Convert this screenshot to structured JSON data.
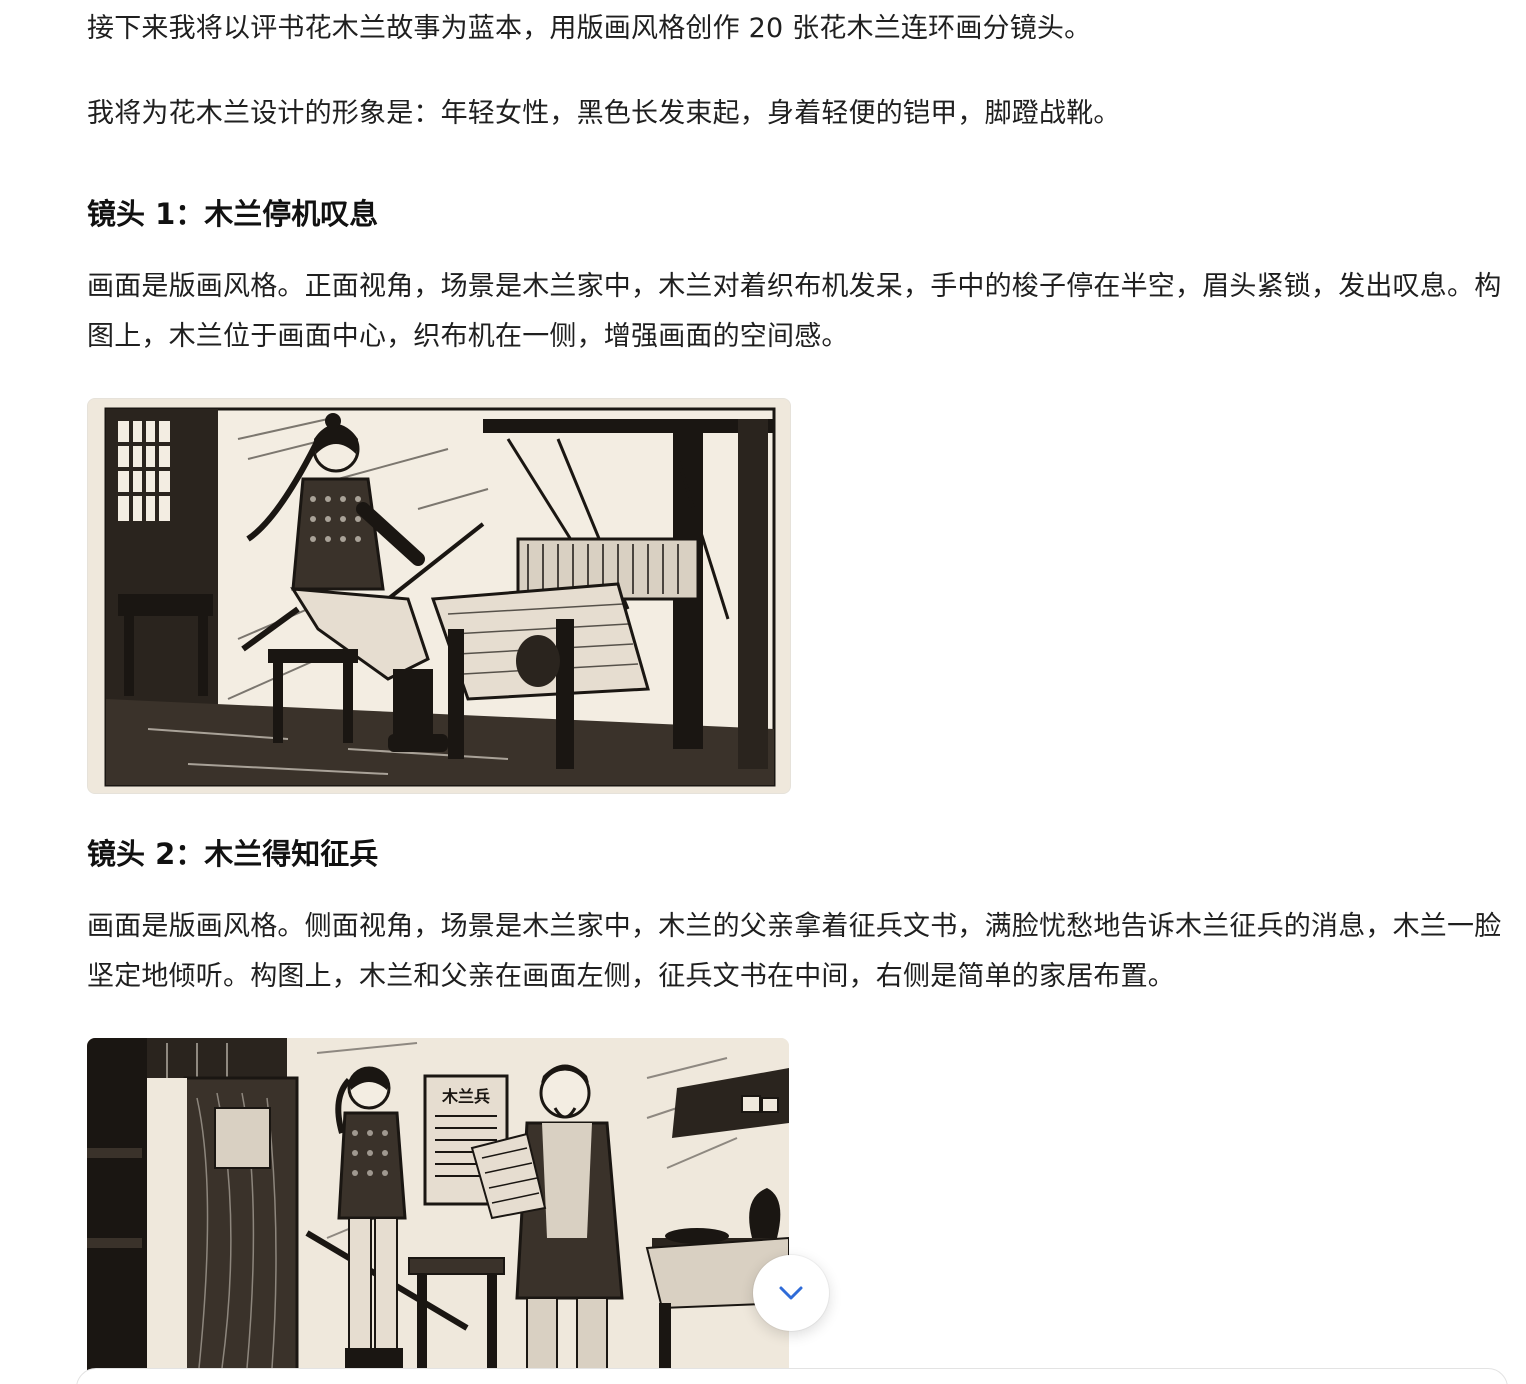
{
  "intro": {
    "line1": "接下来我将以评书花木兰故事为蓝本，用版画风格创作 20 张花木兰连环画分镜头。",
    "line2": "我将为花木兰设计的形象是：年轻女性，黑色长发束起，身着轻便的铠甲，脚蹬战靴。"
  },
  "shots": [
    {
      "title": "镜头 1：木兰停机叹息",
      "description": "画面是版画风格。正面视角，场景是木兰家中，木兰对着织布机发呆，手中的梭子停在半空，眉头紧锁，发出叹息。构图上，木兰位于画面中心，织布机在一侧，增强画面的空间感。"
    },
    {
      "title": "镜头 2：木兰得知征兵",
      "description": "画面是版画风格。侧面视角，场景是木兰家中，木兰的父亲拿着征兵文书，满脸忧愁地告诉木兰征兵的消息，木兰一脸坚定地倾听。构图上，木兰和父亲在画面左侧，征兵文书在中间，右侧是简单的家居布置。",
      "poster_text": "木兰兵"
    }
  ],
  "controls": {
    "scroll_down_icon": "chevron-down-icon"
  },
  "colors": {
    "accent": "#2f6bd8",
    "ink": "#1a1612",
    "paper": "#efe8dc"
  }
}
